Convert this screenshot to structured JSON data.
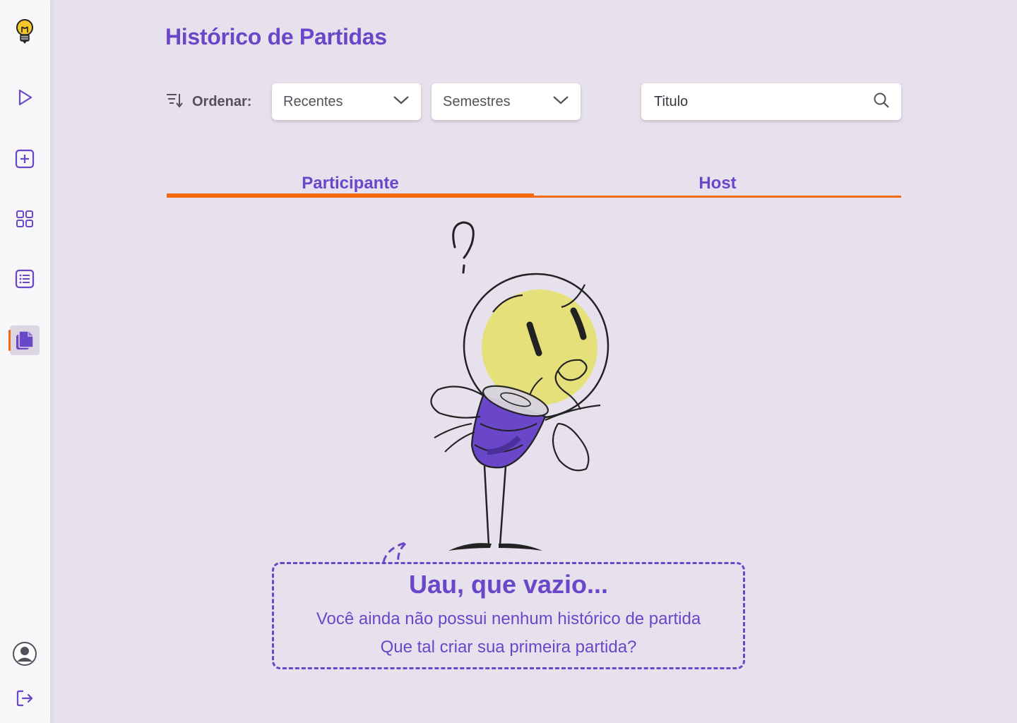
{
  "sidebar": {
    "items": [
      {
        "icon": "lightbulb-logo-icon"
      },
      {
        "icon": "play-icon"
      },
      {
        "icon": "add-square-icon"
      },
      {
        "icon": "grid-icon"
      },
      {
        "icon": "list-icon"
      },
      {
        "icon": "documents-icon",
        "active": true
      }
    ],
    "bottom": [
      {
        "icon": "user-avatar-icon"
      },
      {
        "icon": "logout-icon"
      }
    ]
  },
  "page": {
    "title": "Histórico de Partidas"
  },
  "filters": {
    "sort_label": "Ordenar:",
    "order_select": "Recentes",
    "semester_select": "Semestres"
  },
  "search": {
    "placeholder": "Titulo"
  },
  "tabs": [
    {
      "label": "Participante",
      "active": true
    },
    {
      "label": "Host",
      "active": false
    }
  ],
  "empty_state": {
    "title": "Uau, que vazio...",
    "line1": "Você ainda não possui nenhum histórico de partida",
    "line2": "Que tal criar sua primeira partida?"
  },
  "colors": {
    "accent": "#6a46c8",
    "highlight": "#f36a10",
    "background": "#e7e1ee"
  }
}
